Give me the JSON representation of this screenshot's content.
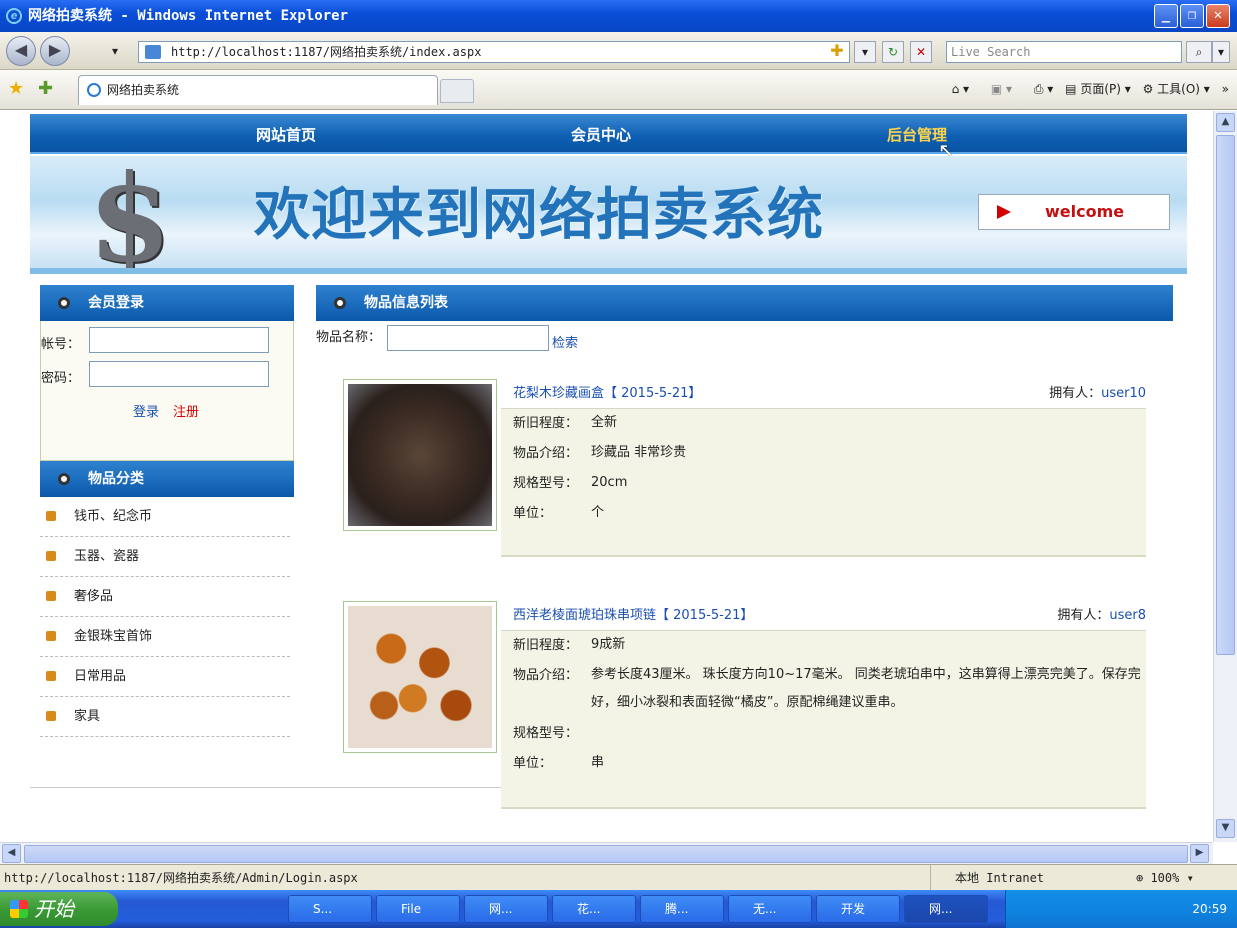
{
  "window": {
    "title": "网络拍卖系统 - Windows Internet Explorer"
  },
  "browser": {
    "url": "http://localhost:1187/网络拍卖系统/index.aspx",
    "search_placeholder": "Live Search",
    "tab_title": "网络拍卖系统",
    "cmd_page": "页面(P)",
    "cmd_tools": "工具(O)"
  },
  "site": {
    "nav": [
      "网站首页",
      "会员中心",
      "后台管理"
    ],
    "banner_title": "欢迎来到网络拍卖系统",
    "banner_welcome": "welcome"
  },
  "login": {
    "heading": "会员登录",
    "account_label": "帐号：",
    "password_label": "密码：",
    "login_link": "登录",
    "register_link": "注册"
  },
  "categories": {
    "heading": "物品分类",
    "items": [
      "钱币、纪念币",
      "玉器、瓷器",
      "奢侈品",
      "金银珠宝首饰",
      "日常用品",
      "家具"
    ]
  },
  "list": {
    "heading": "物品信息列表",
    "search_label": "物品名称：",
    "search_button": "检索",
    "items": [
      {
        "title": "花梨木珍藏画盒【 2015-5-21】",
        "owner_label": "拥有人：",
        "owner": "user10",
        "condition_label": "新旧程度：",
        "condition": "全新",
        "intro_label": "物品介绍：",
        "intro": "珍藏品 非常珍贵",
        "spec_label": "规格型号：",
        "spec": "20cm",
        "unit_label": "单位：",
        "unit": "个"
      },
      {
        "title": "西洋老棱面琥珀珠串项链【 2015-5-21】",
        "owner_label": "拥有人：",
        "owner": "user8",
        "condition_label": "新旧程度：",
        "condition": "9成新",
        "intro_label": "物品介绍：",
        "intro": "参考长度43厘米。 珠长度方向10~17毫米。 同类老琥珀串中，这串算得上漂亮完美了。保存完好，细小冰裂和表面轻微“橘皮”。原配棉绳建议重串。",
        "spec_label": "规格型号：",
        "spec": "",
        "unit_label": "单位：",
        "unit": "串"
      }
    ]
  },
  "status": {
    "text": "http://localhost:1187/网络拍卖系统/Admin/Login.aspx",
    "zone": "本地 Intranet",
    "zoom": "100%"
  },
  "taskbar": {
    "start": "开始",
    "tasks": [
      "S...",
      "File",
      "网...",
      "花...",
      "腾...",
      "无...",
      "开发",
      "网..."
    ],
    "clock": "20:59"
  },
  "colors": {
    "nav_blue": "#0e5eb2",
    "link_blue": "#1a4fb0",
    "highlight": "#ffd54a",
    "register_red": "#dd0000"
  }
}
